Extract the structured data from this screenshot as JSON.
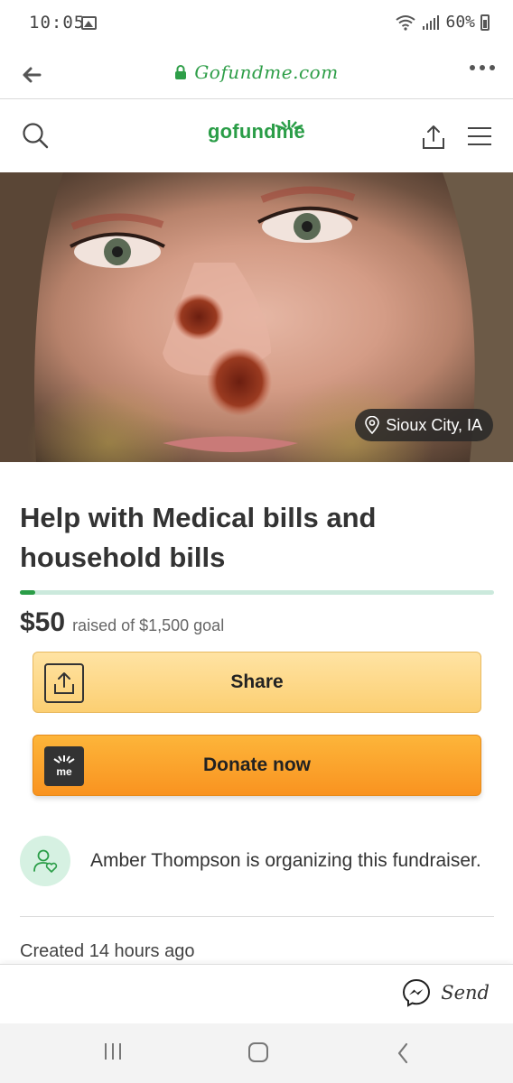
{
  "status_bar": {
    "time": "10:05",
    "battery": "60%"
  },
  "browser": {
    "url": "Gofundme.com"
  },
  "header": {
    "logo": "gofundme"
  },
  "hero": {
    "location": "Sioux City, IA"
  },
  "campaign": {
    "title": "Help with Medical bills and household bills",
    "raised_amount": "$50",
    "raised_goal_text": "raised of $1,500 goal",
    "progress_fraction": 0.033,
    "share_label": "Share",
    "donate_label": "Donate now",
    "organizer_text": "Amber Thompson is organizing this fundraiser.",
    "created_text": "Created 14 hours ago",
    "donate_icon_text": "me"
  },
  "send_bar": {
    "send_label": "Send"
  },
  "colors": {
    "brand_green": "#2a9d47",
    "donate_orange": "#f9a52a",
    "share_yellow": "#fdd987"
  }
}
